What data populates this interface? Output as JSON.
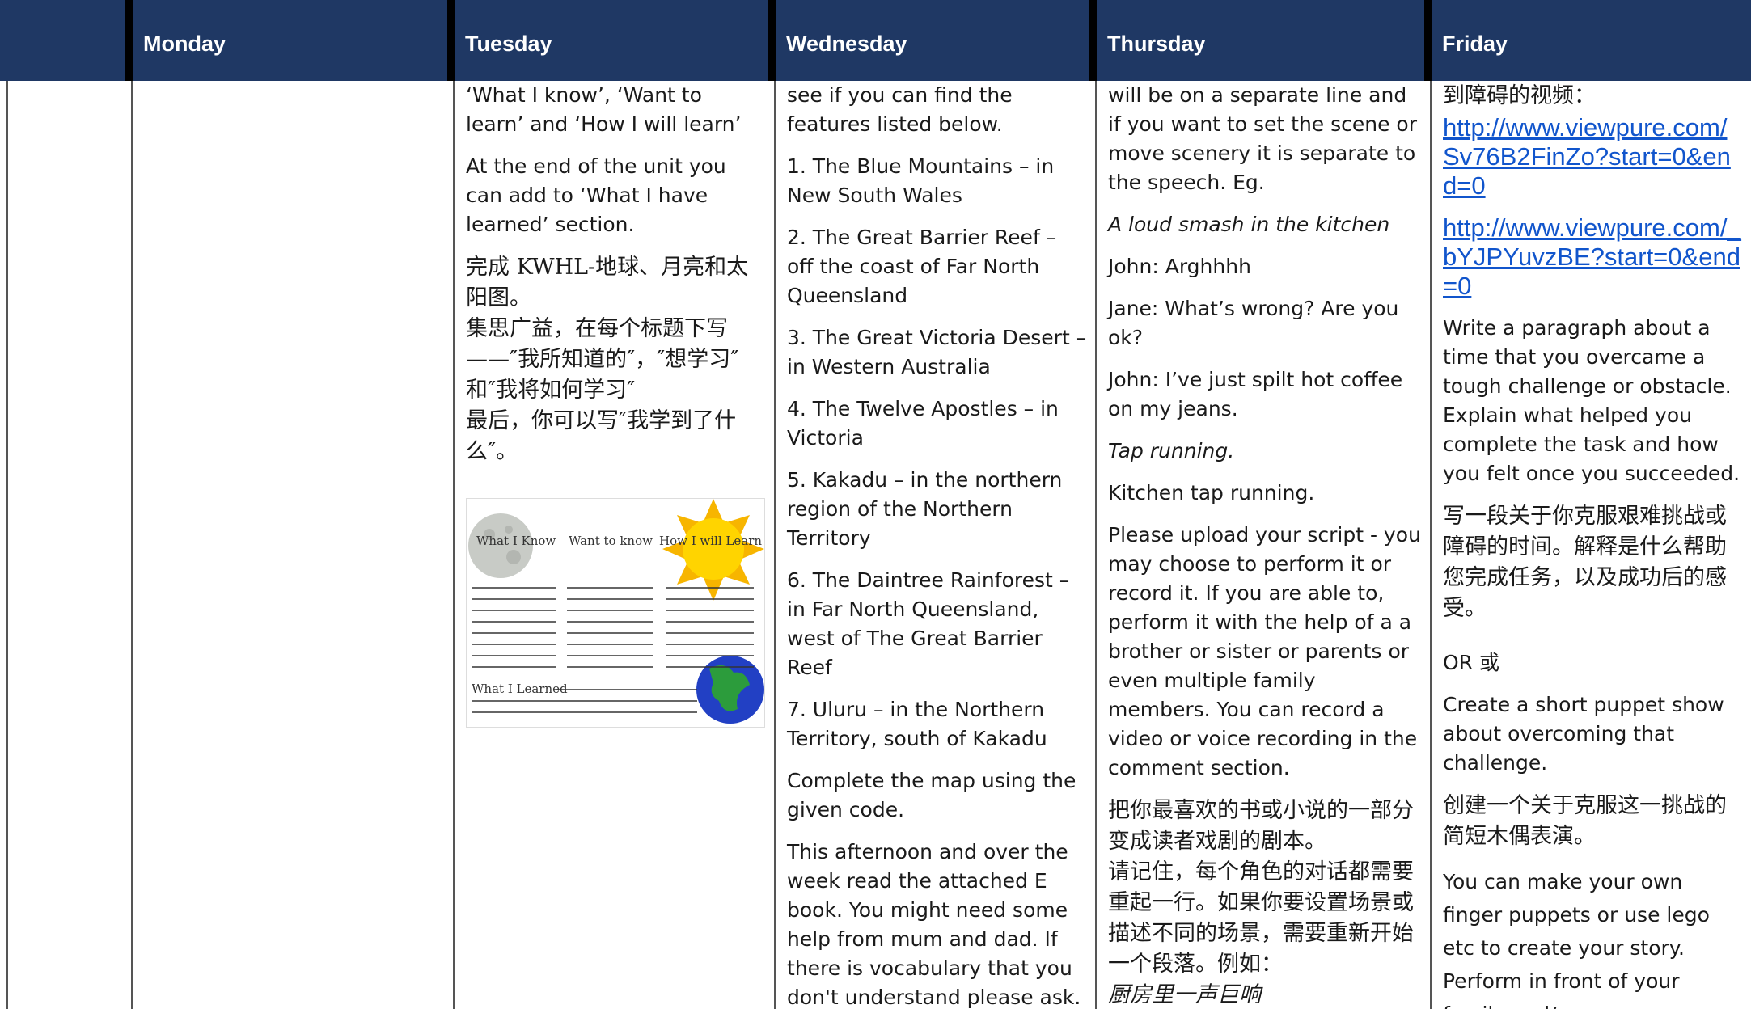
{
  "header": {
    "days": [
      "Monday",
      "Tuesday",
      "Wednesday",
      "Thursday",
      "Friday"
    ]
  },
  "tuesday": {
    "p1": "‘What I know’, ‘Want to learn’ and ‘How I will learn’",
    "p2": "At the end of the unit you can add to ‘What I have learned’ section.",
    "zh1": "完成 KWHL-地球、月亮和太阳图。",
    "zh2": "集思广益，在每个标题下写——″我所知道的″，″想学习″和″我将如何学习″",
    "zh3": "最后，你可以写″我学到了什么″。",
    "chart_labels": {
      "know": "What I Know",
      "want": "Want to know",
      "how": "How I will Learn",
      "learned": "What I Learned"
    }
  },
  "wednesday": {
    "intro": "see if you can find the features listed below.",
    "items": [
      " 1. The Blue Mountains – in New South Wales",
      "2. The Great Barrier Reef – off the coast of Far North Queensland",
      "3. The Great Victoria Desert – in Western Australia",
      "4. The Twelve Apostles – in Victoria",
      "5. Kakadu – in the northern region of the Northern Territory",
      "6. The Daintree Rainforest – in Far North Queensland, west of The Great Barrier Reef",
      "7. Uluru – in the Northern Territory, south of Kakadu"
    ],
    "map": "Complete the map using the given code.",
    "afternoon": "This afternoon and over the week read the attached E book. You might need some help from mum and dad. If there is vocabulary that you don't understand please ask. Think about each area, the"
  },
  "thursday": {
    "p1": "will be on a separate line and if you want to set the scene or move scenery it is separate to the speech. Eg.",
    "p2": "A loud smash in the kitchen",
    "p3": "John: Arghhhh",
    "p4": "Jane: What’s wrong? Are you ok?",
    "p5": "John: I’ve just spilt hot coffee on my jeans.",
    "p6": "Tap running.",
    "p7": "Kitchen tap running.",
    "p8": " Please upload your script - you may choose to perform it or record it. If you are able to, perform it with the help of a a brother or sister or parents or even multiple family members. You can record a video or voice recording in the comment section.",
    "zh1": "把你最喜欢的书或小说的一部分变成读者戏剧的剧本。",
    "zh2": "请记住，每个角色的对话都需要重起一行。如果你要设置场景或描述不同的场景，需要重新开始一个段落。例如：",
    "zh3": "厨房里一声巨响"
  },
  "friday": {
    "zh0": "到障碍的视频：",
    "link1": "http://www.viewpure.com/Sv76B2FinZo?start=0&end=0",
    "link2": "http://www.viewpure.com/_bYJPYuvzBE?start=0&end=0",
    "p1": "Write a paragraph about a time that you overcame a tough challenge or obstacle. Explain what helped you complete the task and how you felt once you succeeded.",
    "zh1": "写一段关于你克服艰难挑战或障碍的时间。解释是什么帮助您完成任务，以及成功后的感受。",
    "or": "OR 或",
    "p2": "Create a short puppet show about overcoming that challenge.",
    "zh2": "创建一个关于克服这一挑战的简短木偶表演。",
    "p3": "You can make your own finger puppets or use lego etc to create your story. Perform in front of your family and/ or"
  }
}
